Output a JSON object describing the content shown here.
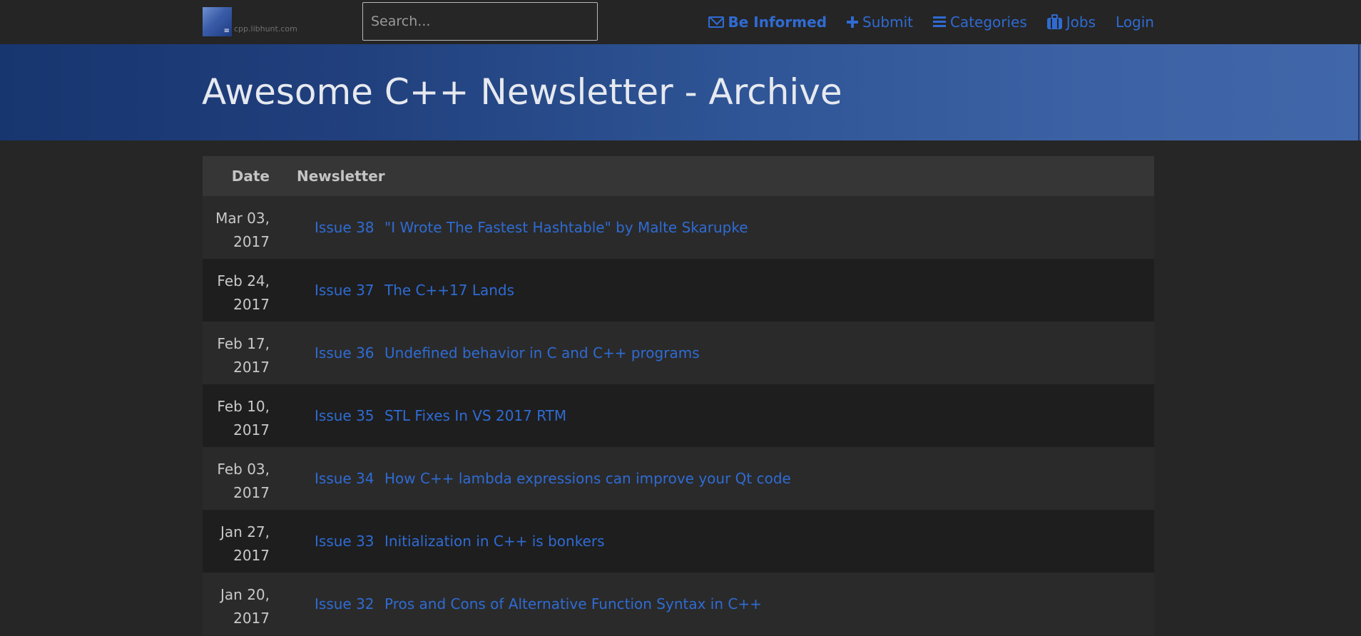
{
  "logo": {
    "domain": "cpp.libhunt.com",
    "glyph": "≡"
  },
  "search": {
    "placeholder": "Search..."
  },
  "nav": {
    "be_informed": "Be Informed",
    "submit": "Submit",
    "categories": "Categories",
    "jobs": "Jobs",
    "login": "Login"
  },
  "banner": {
    "title": "Awesome C++ Newsletter - Archive"
  },
  "table": {
    "headers": {
      "date": "Date",
      "newsletter": "Newsletter"
    },
    "rows": [
      {
        "date_line1": "Mar 03,",
        "date_line2": "2017",
        "issue": "Issue 38",
        "title": "\"I Wrote The Fastest Hashtable\" by Malte Skarupke"
      },
      {
        "date_line1": "Feb 24,",
        "date_line2": "2017",
        "issue": "Issue 37",
        "title": "The C++17 Lands"
      },
      {
        "date_line1": "Feb 17,",
        "date_line2": "2017",
        "issue": "Issue 36",
        "title": "Undefined behavior in C and C++ programs"
      },
      {
        "date_line1": "Feb 10,",
        "date_line2": "2017",
        "issue": "Issue 35",
        "title": "STL Fixes In VS 2017 RTM"
      },
      {
        "date_line1": "Feb 03,",
        "date_line2": "2017",
        "issue": "Issue 34",
        "title": "How C++ lambda expressions can improve your Qt code"
      },
      {
        "date_line1": "Jan 27,",
        "date_line2": "2017",
        "issue": "Issue 33",
        "title": "Initialization in C++ is bonkers"
      },
      {
        "date_line1": "Jan 20,",
        "date_line2": "2017",
        "issue": "Issue 32",
        "title": "Pros and Cons of Alternative Function Syntax in C++"
      }
    ]
  },
  "colors": {
    "background": "#262626",
    "link": "#2f6bd3",
    "banner_start": "#17356f",
    "banner_end": "#4167aa"
  }
}
